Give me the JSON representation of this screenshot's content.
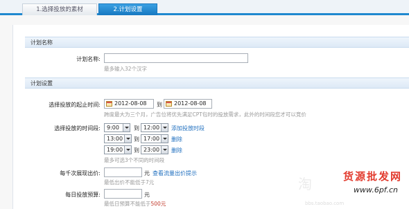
{
  "tabs": [
    {
      "label": "1.选择投放的素材"
    },
    {
      "label": "2.计划设置"
    }
  ],
  "section_name": {
    "title": "计划名称"
  },
  "plan_name": {
    "label": "计划名称:",
    "value": "",
    "hint": "最多输入32个汉字"
  },
  "section_settings": {
    "title": "计划设置"
  },
  "date_range": {
    "label": "选择投放的起止时间:",
    "start": "2012-08-08",
    "sep": "到",
    "end": "2012-08-08",
    "hint": "跨度最大为三个月，广告位将优先满足CPT包时的投放需求，此外的时间段您才可以竞价"
  },
  "time_slots": {
    "label": "选择投放的时间段:",
    "sep": "到",
    "rows": [
      {
        "start": "9:00",
        "end": "12:00",
        "action": "添加投放时段"
      },
      {
        "start": "13:00",
        "end": "17:00",
        "action": "删除"
      },
      {
        "start": "19:00",
        "end": "23:00",
        "action": "删除"
      }
    ],
    "hint": "最多可选3个不同的时间段"
  },
  "cpm_bid": {
    "label": "每千次展现出价:",
    "value": "",
    "unit": "元",
    "link": "查看流量出价提示",
    "hint": "最低出价不能低于7元"
  },
  "daily_budget": {
    "label": "每日投放预算:",
    "value": "",
    "unit": "元",
    "hint_prefix": "最低日预算不能低于",
    "hint_amount": "500元"
  },
  "watermark": {
    "main": "货源批发网",
    "url": "www.6pf.cn",
    "faint": "淘",
    "faint_url": "bbs.taobao.com"
  },
  "colors": {
    "accent": "#1f88cf",
    "link": "#1f6fbf",
    "warning": "#c0392b",
    "section_bg": "#dde9f6"
  }
}
